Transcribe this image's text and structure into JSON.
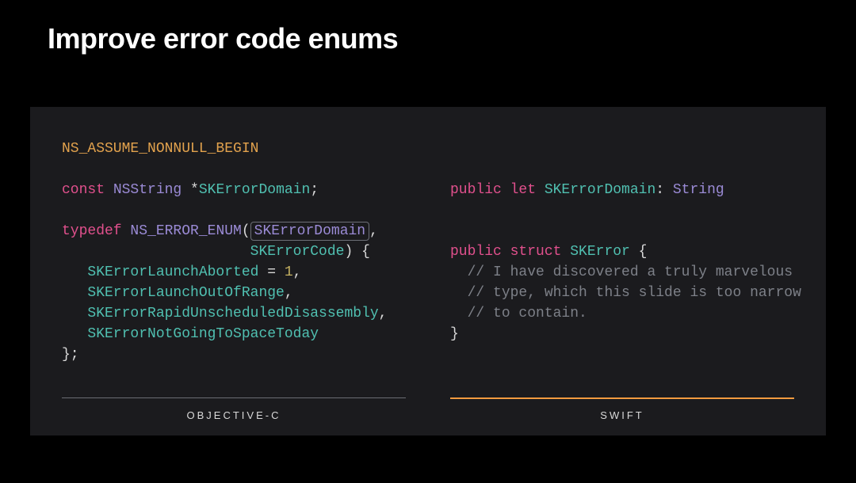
{
  "title": "Improve error code enums",
  "left": {
    "lang_label": "OBJECTIVE-C",
    "l1": "NS_ASSUME_NONNULL_BEGIN",
    "l3_kw": "const",
    "l3_type": " NSString ",
    "l3_plain": "*",
    "l3_ident": "SKErrorDomain",
    "l3_end": ";",
    "l5_kw": "typedef",
    "l5_type": " NS_ERROR_ENUM",
    "l5_plain1": "(",
    "l5_boxed": "SKErrorDomain",
    "l5_plain2": ",",
    "l6_ws": "                      ",
    "l6_ident": "SKErrorCode",
    "l6_plain": ") {",
    "l7_ws": "   ",
    "l7_ident": "SKErrorLaunchAborted",
    "l7_plain1": " = ",
    "l7_num": "1",
    "l7_plain2": ",",
    "l8_ws": "   ",
    "l8_ident": "SKErrorLaunchOutOfRange",
    "l8_plain": ",",
    "l9_ws": "   ",
    "l9_ident": "SKErrorRapidUnscheduledDisassembly",
    "l9_plain": ",",
    "l10_ws": "   ",
    "l10_ident": "SKErrorNotGoingToSpaceToday",
    "l11_plain": "};"
  },
  "right": {
    "lang_label": "SWIFT",
    "l3_kw1": "public",
    "l3_kw2": " let",
    "l3_ident": " SKErrorDomain",
    "l3_plain": ": ",
    "l3_type": "String",
    "l5_kw1": "public",
    "l5_kw2": " struct",
    "l5_ident": " SKError",
    "l5_plain": " {",
    "l6_ws": "  ",
    "l6_comment": "// I have discovered a truly marvelous",
    "l7_ws": "  ",
    "l7_comment": "// type, which this slide is too narrow",
    "l8_ws": "  ",
    "l8_comment": "// to contain.",
    "l9_plain": "}"
  }
}
